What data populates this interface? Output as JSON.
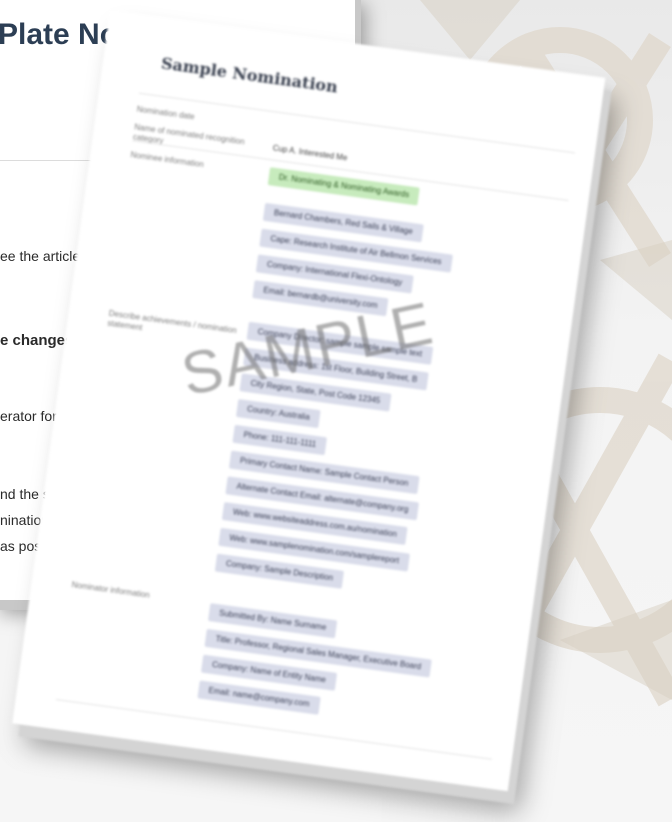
{
  "back_page": {
    "title": "Plate Nom",
    "lines": [
      {
        "before": "ee the article ",
        "link": "he"
      },
      {
        "text": "e changes la"
      },
      {
        "text": "erator for th"
      },
      {
        "text": "nd the sel"
      },
      {
        "text": "nination s"
      },
      {
        "text": "as poss"
      }
    ]
  },
  "front_page": {
    "title": "Sample Nomination",
    "watermark": "SAMPLE",
    "rows": [
      {
        "label": "Nomination date",
        "value": ""
      },
      {
        "label": "Name of nominated recognition category",
        "value": "Cup A. Interested Me"
      }
    ],
    "sections": [
      {
        "label": "Nominee information",
        "chips": [
          {
            "text": "Dr. Nominating & Nominating Awards",
            "green": true
          },
          {
            "text": "Bernard Chambers, Red Sails & Village"
          },
          {
            "text": "Cape: Research Institute of Air Bellmon Services"
          },
          {
            "text": "Company: International Flexi-Ontology"
          },
          {
            "text": "Email: bernardb@university.com"
          }
        ]
      },
      {
        "label": "Describe achievements / nomination statement",
        "chips": [
          {
            "text": "Company Director: sample sample sample text"
          },
          {
            "text": "Business address: 1st Floor, Building Street, B"
          },
          {
            "text": "City Region, State, Post Code 12345"
          },
          {
            "text": "Country: Australia"
          },
          {
            "text": "Phone: 111-111-1111"
          },
          {
            "text": "Primary Contact Name: Sample Contact Person"
          },
          {
            "text": "Alternate Contact Email: alternate@company.org"
          },
          {
            "text": "Web: www.websiteaddress.com.au/nomination"
          },
          {
            "text": "Web: www.samplenomination.com/samplereport"
          },
          {
            "text": "Company: Sample Description"
          }
        ]
      },
      {
        "label": "Nominator information",
        "chips": [
          {
            "text": "Submitted By: Name Surname"
          },
          {
            "text": "Title: Professor, Regional Sales Manager, Executive Board"
          },
          {
            "text": "Company: Name of Entity Name"
          },
          {
            "text": "Email: name@company.com"
          }
        ]
      }
    ]
  }
}
